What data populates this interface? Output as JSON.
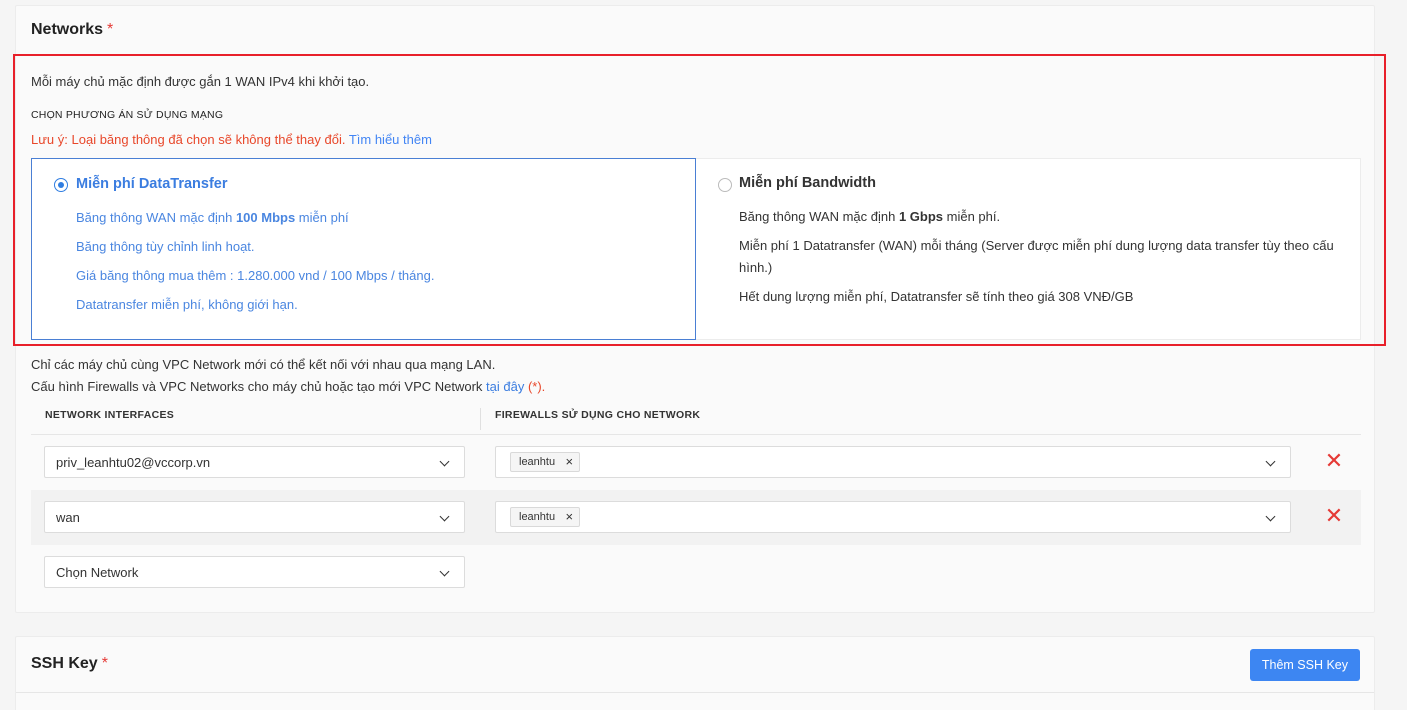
{
  "networks": {
    "title": "Networks",
    "required_mark": "*",
    "intro": "Mỗi máy chủ mặc định được gắn 1 WAN IPv4 khi khởi tạo.",
    "section_label": "CHỌN PHƯƠNG ÁN SỬ DỤNG MẠNG",
    "warning": "Lưu ý: Loại băng thông đã chọn sẽ không thể thay đổi.",
    "warning_link": "Tìm hiểu thêm",
    "options": [
      {
        "title": "Miễn phí DataTransfer",
        "selected": true,
        "line1_pre": "Băng thông WAN mặc định ",
        "line1_bold": "100 Mbps",
        "line1_post": " miễn phí",
        "line2": "Băng thông tùy chỉnh linh hoạt.",
        "line3": "Giá băng thông mua thêm : 1.280.000 vnd / 100 Mbps / tháng.",
        "line4": "Datatransfer miễn phí, không giới hạn."
      },
      {
        "title": "Miễn phí Bandwidth",
        "selected": false,
        "line1_pre": "Băng thông WAN mặc định ",
        "line1_bold": "1 Gbps",
        "line1_post": " miễn phí.",
        "line2": "Miễn phí 1 Datatransfer (WAN) mỗi tháng (Server được miễn phí dung lượng data transfer tùy theo cấu hình.)",
        "line3": "Hết dung lượng miễn phí, Datatransfer sẽ tính theo giá 308 VNĐ/GB"
      }
    ],
    "note1": "Chỉ các máy chủ cùng VPC Network mới có thể kết nối với nhau qua mạng LAN.",
    "note2_pre": "Cấu hình Firewalls và VPC Networks cho máy chủ hoặc tạo mới VPC Network ",
    "note2_link": "tại đây",
    "note2_post": " (*).",
    "col_interfaces": "NETWORK INTERFACES",
    "col_firewalls": "FIREWALLS SỬ DỤNG CHO NETWORK",
    "rows": [
      {
        "network": "priv_leanhtu02@vccorp.vn",
        "firewall_tag": "leanhtu"
      },
      {
        "network": "wan",
        "firewall_tag": "leanhtu"
      }
    ],
    "add_placeholder": "Chọn Network",
    "remove_icon": "close-x-icon",
    "accent_color": "#3b7de0",
    "danger_color": "#e53935"
  },
  "ssh": {
    "title": "SSH Key",
    "required_mark": "*",
    "add_button": "Thêm SSH Key"
  }
}
